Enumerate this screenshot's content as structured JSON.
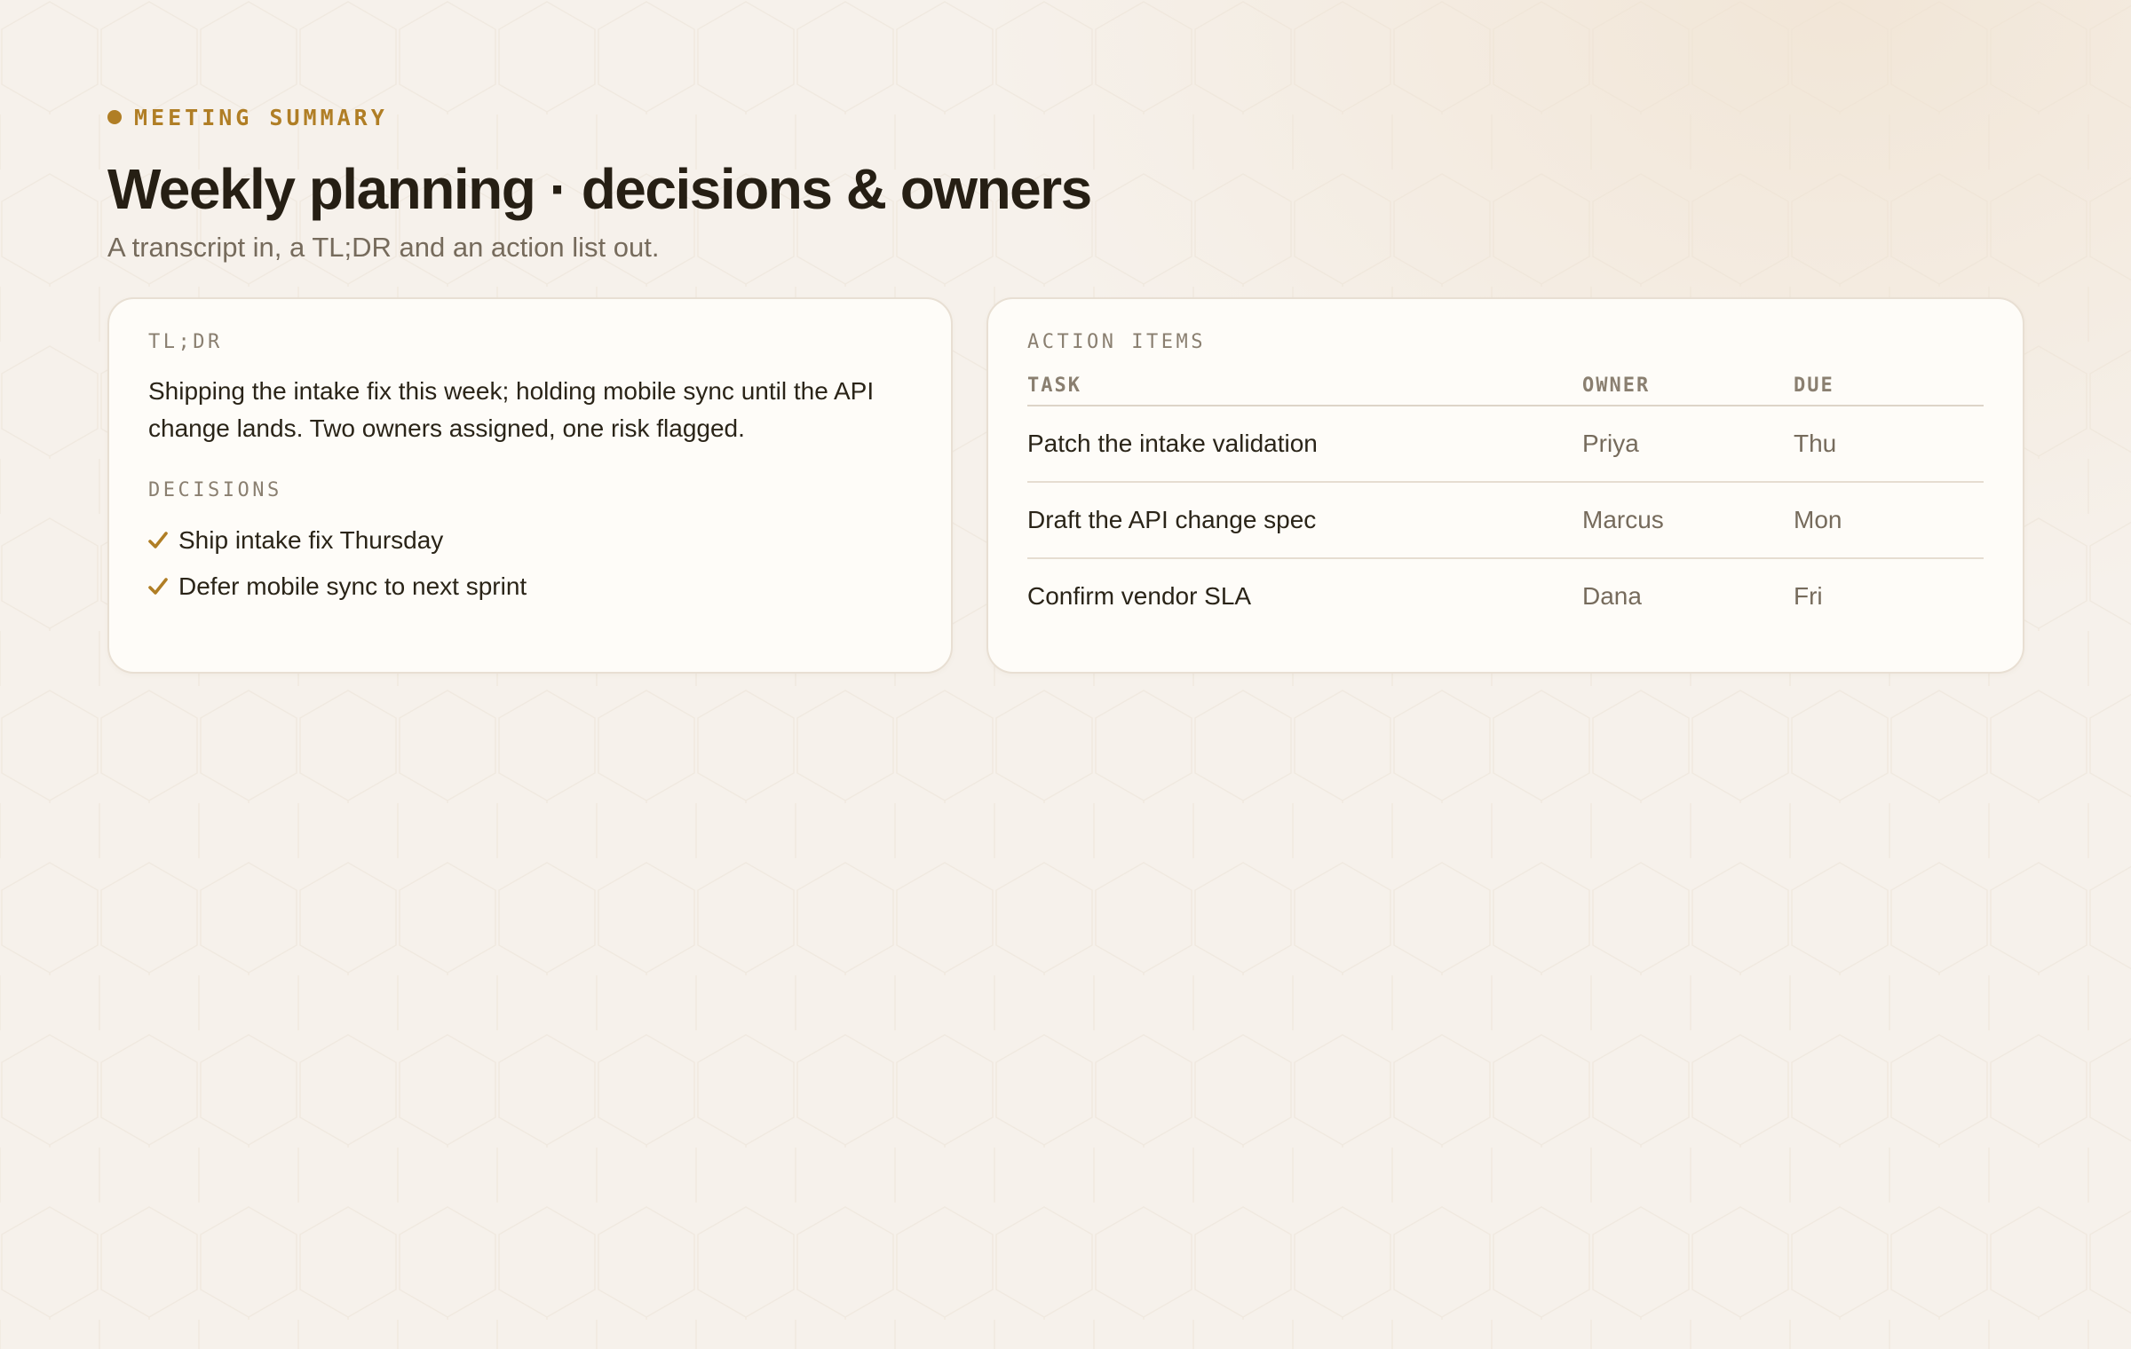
{
  "header": {
    "eyebrow": "MEETING SUMMARY",
    "title": "Weekly planning · decisions & owners",
    "subtitle": "A transcript in, a TL;DR and an action list out."
  },
  "tldr": {
    "label": "TL;DR",
    "text": "Shipping the intake fix this week; holding mobile sync until the API change lands. Two owners assigned, one risk flagged.",
    "decisions_label": "DECISIONS",
    "decisions": [
      {
        "icon": "check-icon",
        "text": "Ship intake fix Thursday"
      },
      {
        "icon": "check-icon",
        "text": "Defer mobile sync to next sprint"
      }
    ]
  },
  "action_items": {
    "label": "ACTION ITEMS",
    "columns": [
      "TASK",
      "OWNER",
      "DUE"
    ],
    "rows": [
      {
        "task": "Patch the intake validation",
        "owner": "Priya",
        "due": "Thu"
      },
      {
        "task": "Draft the API change spec",
        "owner": "Marcus",
        "due": "Mon"
      },
      {
        "task": "Confirm vendor SLA",
        "owner": "Dana",
        "due": "Fri"
      }
    ]
  },
  "colors": {
    "accent": "#b07e25",
    "background": "#f6f1eb",
    "card": "#fefcf8",
    "text": "#2a2418",
    "muted": "#766b5c"
  }
}
